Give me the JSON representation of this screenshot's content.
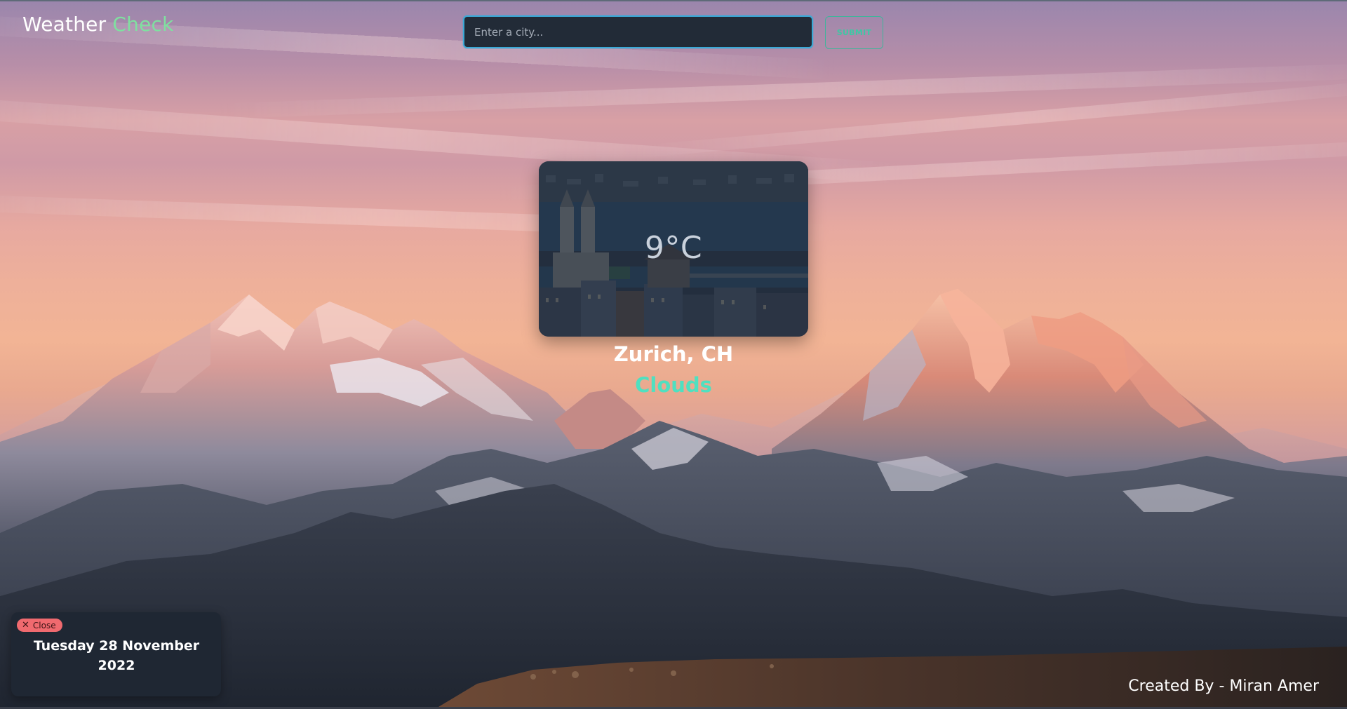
{
  "header": {
    "brand_word1": "Weather",
    "brand_word2": "Check",
    "brand_accent_color": "#7fe0a0"
  },
  "search": {
    "placeholder": "Enter a city...",
    "value": "",
    "submit_label": "SUBMIT"
  },
  "weather": {
    "temperature": "9°C",
    "location": "Zurich, CH",
    "condition": "Clouds",
    "condition_color": "#4fe0c0"
  },
  "date_panel": {
    "close_label": "Close",
    "close_icon": "x-icon",
    "date_line1": "Tuesday 28 November",
    "date_line2": "2022"
  },
  "footer": {
    "credit": "Created By - Miran Amer"
  }
}
